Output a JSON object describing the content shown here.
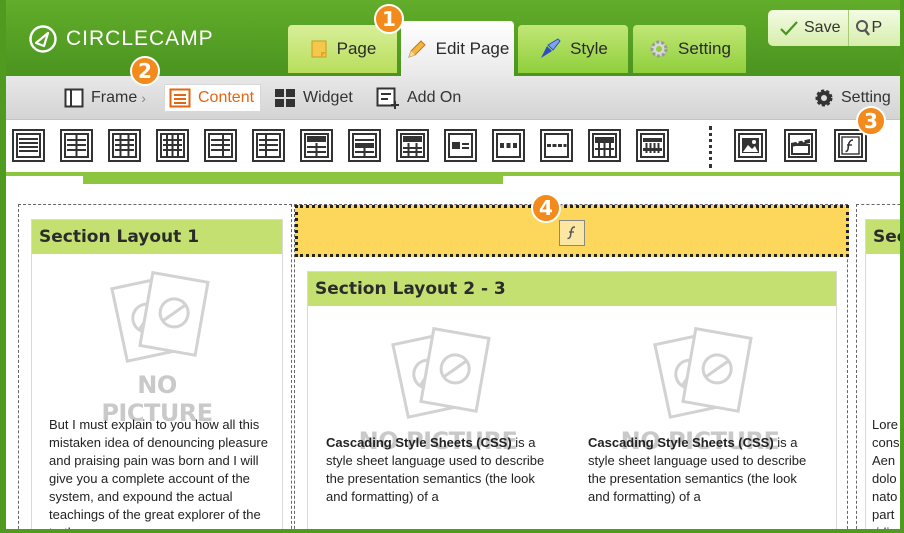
{
  "app": {
    "logo_text": "CIRCLECAMP"
  },
  "tabs": [
    {
      "label": "Page",
      "icon": "page-icon"
    },
    {
      "label": "Edit Page",
      "icon": "pencil-icon",
      "active": true
    },
    {
      "label": "Style",
      "icon": "brush-icon"
    },
    {
      "label": "Setting",
      "icon": "gear-icon"
    }
  ],
  "actions": {
    "save_label": "Save",
    "preview_label": "P"
  },
  "subnav": {
    "frame": "Frame",
    "breadcrumb_sep": "›",
    "content": "Content",
    "widget": "Widget",
    "add_on": "Add On",
    "setting": "Setting"
  },
  "callouts": [
    "1",
    "2",
    "3",
    "4"
  ],
  "sections": {
    "s1_title": "Section Layout 1",
    "s2_title": "Section Layout 2 - 3",
    "s3_title": "Sect"
  },
  "placeholder": {
    "label": "NO PICTURE"
  },
  "texts": {
    "s1_body": "But I must explain to you how all this mistaken idea of denouncing pleasure and praising pain was born and I will give you a complete account of the system, and expound the actual teachings of the great explorer of the truth",
    "css_term": "Cascading Style Sheets (CSS)",
    "css_rest": " is a style sheet language used to describe the presentation semantics (the look and formatting) of a",
    "s3_body": "Lore cons Aen dolo nato part ridic"
  },
  "colors": {
    "brand_green": "#4a9420",
    "accent_orange": "#f28a1c",
    "section_header": "#c3e070",
    "drop_zone": "#fcd75b"
  }
}
